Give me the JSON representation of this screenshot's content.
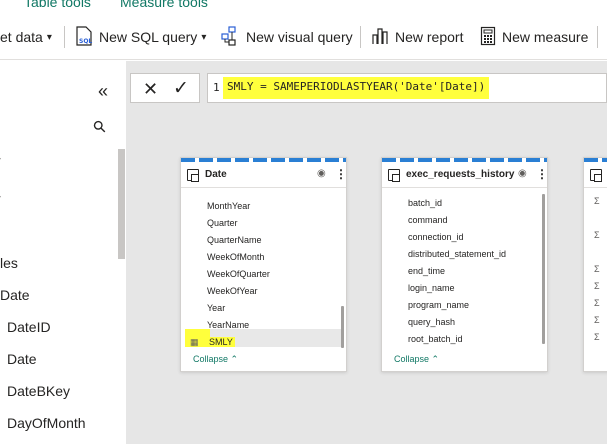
{
  "tabs": {
    "table_tools": "Table tools",
    "measure_tools": "Measure tools"
  },
  "ribbon": {
    "get_data": "et data",
    "new_sql_query": "New SQL query",
    "new_visual_query": "New visual query",
    "new_report": "New report",
    "new_measure": "New measure"
  },
  "left_panel": {
    "collapse_glyph": "«",
    "search_glyph": "⚲",
    "items": [
      "les",
      "Date",
      "DateID",
      "Date",
      "DateBKey",
      "DayOfMonth"
    ]
  },
  "formula_bar": {
    "cancel_glyph": "✕",
    "commit_glyph": "✓",
    "line_number": "1",
    "expression": "SMLY = SAMEPERIODLASTYEAR('Date'[Date])"
  },
  "cards": {
    "date": {
      "title": "Date",
      "fields": [
        "MonthYear",
        "Quarter",
        "QuarterName",
        "WeekOfMonth",
        "WeekOfQuarter",
        "WeekOfYear",
        "Year",
        "YearName",
        "SMLY"
      ],
      "collapse": "Collapse ⌃"
    },
    "exec": {
      "title": "exec_requests_history",
      "fields": [
        "batch_id",
        "command",
        "connection_id",
        "distributed_statement_id",
        "end_time",
        "login_name",
        "program_name",
        "query_hash",
        "root_batch_id"
      ],
      "collapse": "Collapse ⌃"
    }
  },
  "colors": {
    "highlight": "#ffff3c",
    "accent": "#117865",
    "table_stripe": "#2a7fd4",
    "canvas": "#e6e6e6"
  }
}
